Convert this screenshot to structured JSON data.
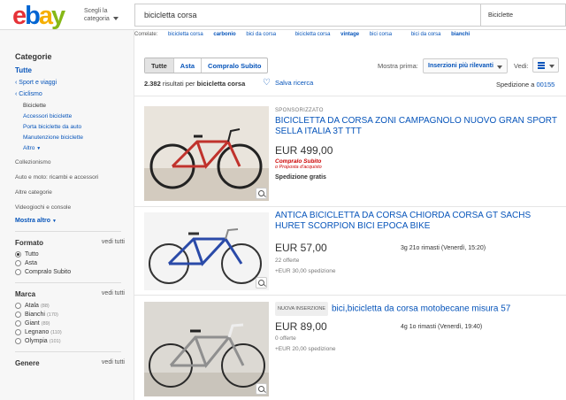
{
  "header": {
    "logo": {
      "e": "e",
      "b": "b",
      "a": "a",
      "y": "y"
    },
    "category_selector": "Scegli la categoria",
    "search_value": "bicicletta corsa",
    "search_category": "Biciclette"
  },
  "related": {
    "label": "Correlate:",
    "items": [
      {
        "plain": "bicicletta corsa",
        "bold": "carbonio"
      },
      {
        "plain": "bici da corsa",
        "bold": ""
      },
      {
        "plain": "bicicletta corsa",
        "bold": "vintage"
      },
      {
        "plain": "bici corsa",
        "bold": ""
      },
      {
        "plain": "bici da corsa",
        "bold": "bianchi"
      }
    ]
  },
  "sidebar": {
    "heading": "Categorie",
    "all": "Tutte",
    "parent": "‹ Sport e viaggi",
    "current": "‹ Ciclismo",
    "children": [
      "Biciclette",
      "Accessori biciclette",
      "Porta biciclette da auto",
      "Manutenzione biciclette"
    ],
    "more_small": "Altro",
    "others": [
      "Collezionismo",
      "Auto e moto: ricambi e accessori",
      "Altre categorie",
      "Videogiochi e console"
    ],
    "show_more": "Mostra altro",
    "format": {
      "heading": "Formato",
      "see_all": "vedi tutti",
      "options": [
        "Tutto",
        "Asta",
        "Compralo Subito"
      ]
    },
    "brand": {
      "heading": "Marca",
      "see_all": "vedi tutti",
      "options": [
        {
          "label": "Atala",
          "count": "(88)"
        },
        {
          "label": "Bianchi",
          "count": "(170)"
        },
        {
          "label": "Giant",
          "count": "(89)"
        },
        {
          "label": "Legnano",
          "count": "(110)"
        },
        {
          "label": "Olympia",
          "count": "(101)"
        }
      ]
    },
    "gender": {
      "heading": "Genere",
      "see_all": "vedi tutti"
    }
  },
  "toolbar": {
    "tabs": [
      "Tutte",
      "Asta",
      "Compralo Subito"
    ],
    "sort_label": "Mostra prima:",
    "sort_value": "Inserzioni più rilevanti",
    "view_label": "Vedi:",
    "results_count": "2.382",
    "results_text": "risultati per",
    "results_query": "bicicletta corsa",
    "save_search": "Salva ricerca",
    "shipping_label": "Spedizione a",
    "shipping_zip": "00155"
  },
  "listings": [
    {
      "sponsored": "SPONSORIZZATO",
      "title": "BICICLETTA DA CORSA ZONI CAMPAGNOLO NUOVO GRAN SPORT SELLA ITALIA 3T TTT",
      "price": "EUR 499,00",
      "badge_line1": "Compralo Subito",
      "badge_line2": "o Proposta d'acquisto",
      "shipping": "Spedizione gratis"
    },
    {
      "title": "ANTICA BICICLETTA DA CORSA CHIORDA CORSA GT SACHS HURET SCORPION BICI EPOCA BIKE",
      "price": "EUR 57,00",
      "offers": "22 offerte",
      "shipping": "+EUR 30,00 spedizione",
      "time_left": "3g 21o rimasti (Venerdì, 15:20)"
    },
    {
      "new_badge": "NUOVA INSERZIONE",
      "title": "bici,bicicletta da corsa motobecane misura 57",
      "price": "EUR 89,00",
      "offers": "0 offerte",
      "shipping": "+EUR 20,00 spedizione",
      "time_left": "4g 1o rimasti (Venerdì, 19:40)"
    }
  ]
}
